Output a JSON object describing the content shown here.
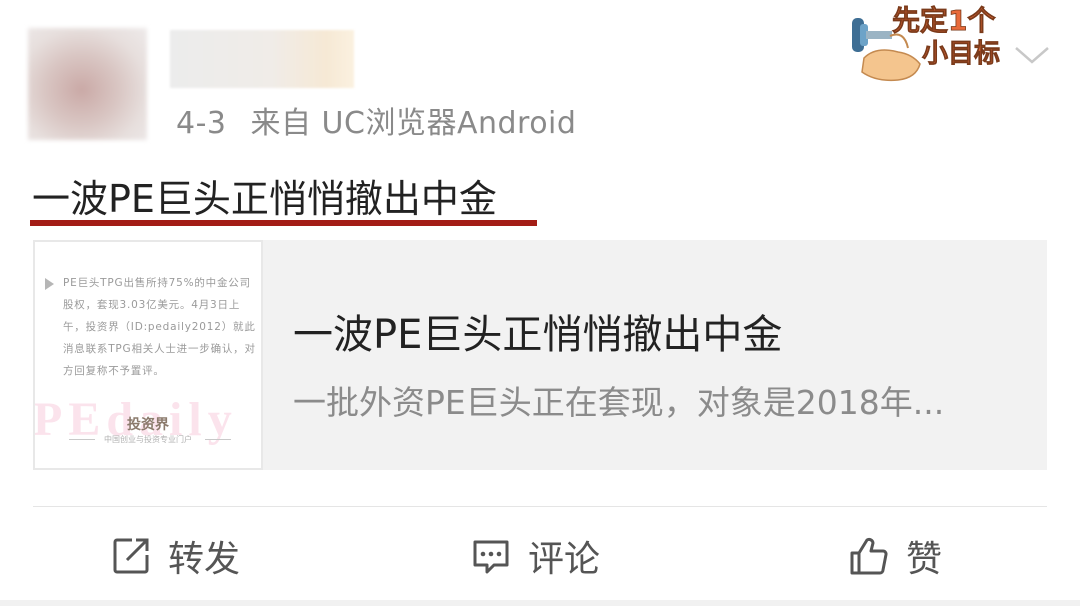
{
  "post": {
    "date": "4-3",
    "source": "来自 UC浏览器Android",
    "title": "一波PE巨头正悄悄撤出中金"
  },
  "badge": {
    "text_line1": "先定1个",
    "text_line2": "小目标"
  },
  "card": {
    "title": "一波PE巨头正悄悄撤出中金",
    "description": "一批外资PE巨头正在套现，对象是2018年...",
    "thumbnail": {
      "text": "PE巨头TPG出售所持75%的中金公司股权，套现3.03亿美元。4月3日上午，投资界（ID:pedaily2012）就此消息联系TPG相关人士进一步确认，对方回复称不予置评。",
      "watermark": "PEdaily",
      "logo": "投资界",
      "tagline": "中国创业与投资专业门户"
    }
  },
  "actions": {
    "repost": "转发",
    "comment": "评论",
    "like": "赞"
  },
  "colors": {
    "underline": "#a31d16",
    "text_primary": "#222222",
    "text_secondary": "#8a8a8a",
    "card_bg": "#f2f2f2"
  },
  "icons": [
    "repost-icon",
    "comment-icon",
    "like-icon",
    "chevron-down-icon",
    "avatar"
  ]
}
